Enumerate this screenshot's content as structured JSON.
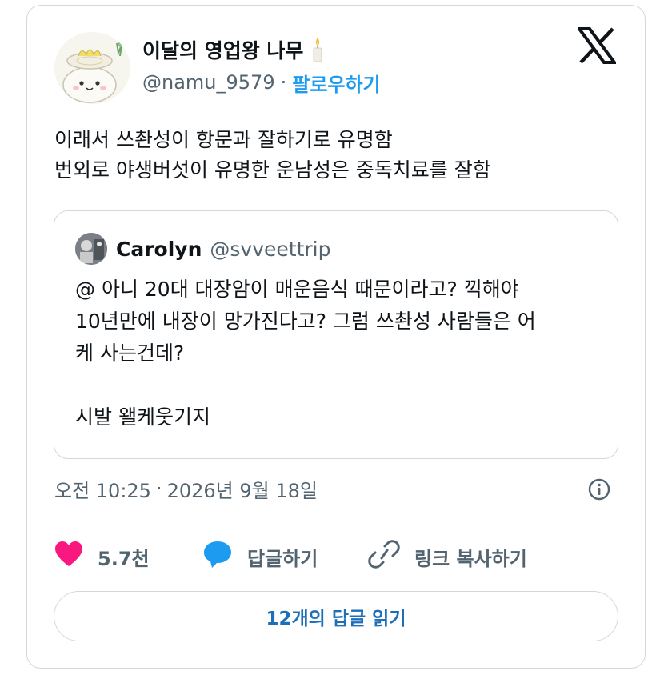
{
  "tweet": {
    "author_name": "이달의 영업왕 나무",
    "handle": "@namu_9579",
    "separator": "·",
    "follow_label": "팔로우하기",
    "text_lines": [
      "이래서 쓰촨성이 항문과 잘하기로 유명함",
      "번외로 야생버섯이 유명한 운남성은 중독치료를 잘함"
    ]
  },
  "quote": {
    "author_name": "Carolyn",
    "handle": "@svveettrip",
    "text_lines": [
      "@ 아니 20대 대장암이 매운음식 때문이라고? 끽해야",
      "10년만에 내장이 망가진다고? 그럼 쓰촨성 사람들은 어",
      "케 사는건데?",
      "시발 왤케웃기지"
    ]
  },
  "meta": {
    "time": "오전 10:25",
    "separator": "·",
    "date": "2026년 9월 18일"
  },
  "actions": {
    "likes_count": "5.7천",
    "reply_label": "답글하기",
    "copy_link_label": "링크 복사하기"
  },
  "read_replies_label": "12개의 답글 읽기",
  "colors": {
    "accent_blue": "#1d9bf0",
    "heart_pink": "#f91880",
    "secondary_text": "#536471",
    "border": "#cfd9de"
  },
  "icons": {
    "brand": "x-logo-icon",
    "emoji": "candle-icon",
    "info": "info-icon",
    "like": "heart-icon",
    "reply": "speech-bubble-icon",
    "copy": "link-icon"
  }
}
